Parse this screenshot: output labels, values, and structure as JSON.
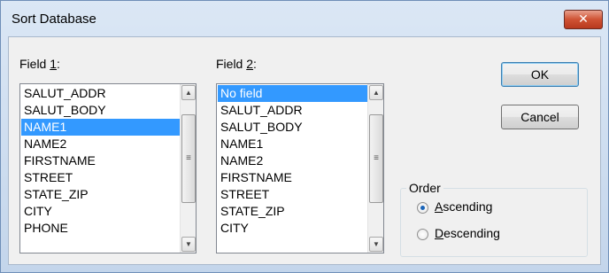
{
  "window": {
    "title": "Sort Database",
    "close_glyph": "✕"
  },
  "field1": {
    "label_mnemonic": "1",
    "label_prefix": "Field ",
    "label_suffix": ":",
    "items": [
      "SALUT_ADDR",
      "SALUT_BODY",
      "NAME1",
      "NAME2",
      "FIRSTNAME",
      "STREET",
      "STATE_ZIP",
      "CITY",
      "PHONE"
    ],
    "selected": "NAME1"
  },
  "field2": {
    "label_mnemonic": "2",
    "label_prefix": "Field ",
    "label_suffix": ":",
    "items": [
      "No field",
      "SALUT_ADDR",
      "SALUT_BODY",
      "NAME1",
      "NAME2",
      "FIRSTNAME",
      "STREET",
      "STATE_ZIP",
      "CITY"
    ],
    "selected": "No field"
  },
  "buttons": {
    "ok": "OK",
    "cancel": "Cancel"
  },
  "order": {
    "title": "Order",
    "ascending_mnemonic": "A",
    "ascending_rest": "scending",
    "descending_mnemonic": "D",
    "descending_rest": "escending",
    "selected": "ascending"
  },
  "scroll": {
    "up_glyph": "▲",
    "down_glyph": "▼",
    "grip_glyph": "≡"
  },
  "colors": {
    "selection": "#3399ff",
    "close_button": "#cf5234"
  }
}
